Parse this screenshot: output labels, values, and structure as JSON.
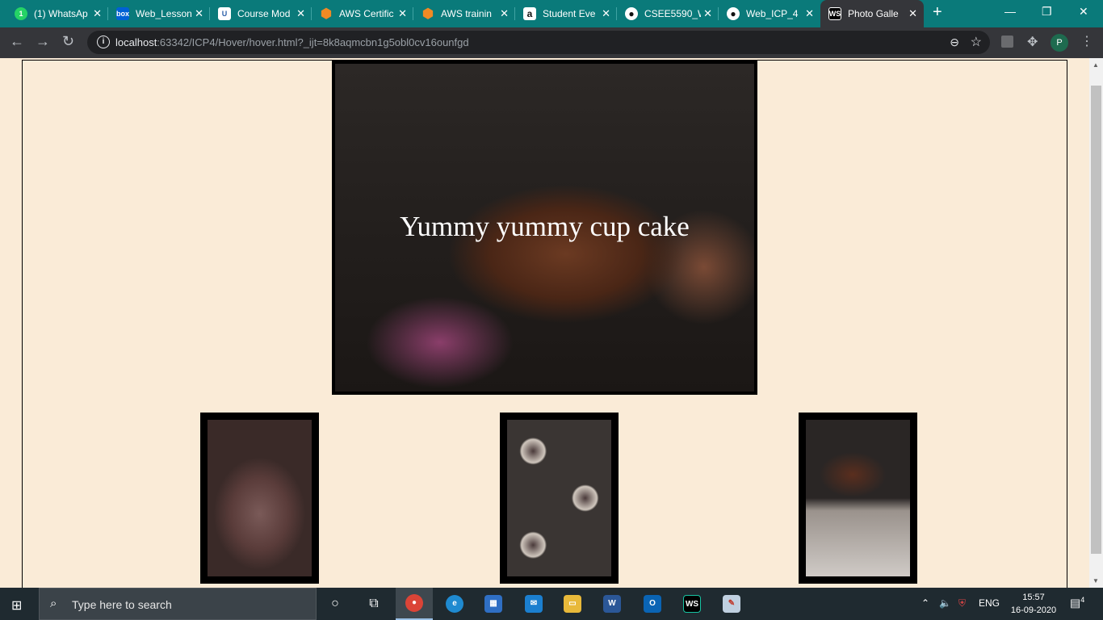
{
  "browser": {
    "tabs": [
      {
        "label": "(1) WhatsAp",
        "icon": "whatsapp-icon",
        "icon_color": "#25d366",
        "glyph": "1"
      },
      {
        "label": "Web_Lesson",
        "icon": "box-icon",
        "icon_color": "#0061d5",
        "glyph": "box"
      },
      {
        "label": "Course Mod",
        "icon": "umkc-icon",
        "icon_color": "#2b5fa8",
        "glyph": "U"
      },
      {
        "label": "AWS Certific",
        "icon": "aws-cube-icon",
        "icon_color": "#f08a24",
        "glyph": "◆"
      },
      {
        "label": "AWS trainin",
        "icon": "aws-cube-icon",
        "icon_color": "#f08a24",
        "glyph": "◆"
      },
      {
        "label": "Student Eve",
        "icon": "amazon-icon",
        "icon_color": "#111111",
        "glyph": "a"
      },
      {
        "label": "CSEE5590_W",
        "icon": "github-icon",
        "icon_color": "#111111",
        "glyph": "●"
      },
      {
        "label": "Web_ICP_4",
        "icon": "github-icon",
        "icon_color": "#111111",
        "glyph": "●"
      },
      {
        "label": "Photo Galle",
        "icon": "webstorm-icon",
        "icon_color": "#000000",
        "glyph": "WS",
        "active": true
      }
    ],
    "url_host": "localhost",
    "url_path": ":63342/ICP4/Hover/hover.html?_ijt=8k8aqmcbn1g5obl0cv16ounfgd",
    "profile_initial": "P"
  },
  "gallery": {
    "hero_caption": "Yummy yummy cup cake",
    "thumbnails": [
      {
        "name": "chocolate-batter-bowl"
      },
      {
        "name": "cupcake-liners-tray"
      },
      {
        "name": "frosted-chocolate-cupcake"
      }
    ]
  },
  "taskbar": {
    "search_placeholder": "Type here to search",
    "language": "ENG",
    "time": "15:57",
    "date": "16-09-2020",
    "notification_count": "4"
  }
}
